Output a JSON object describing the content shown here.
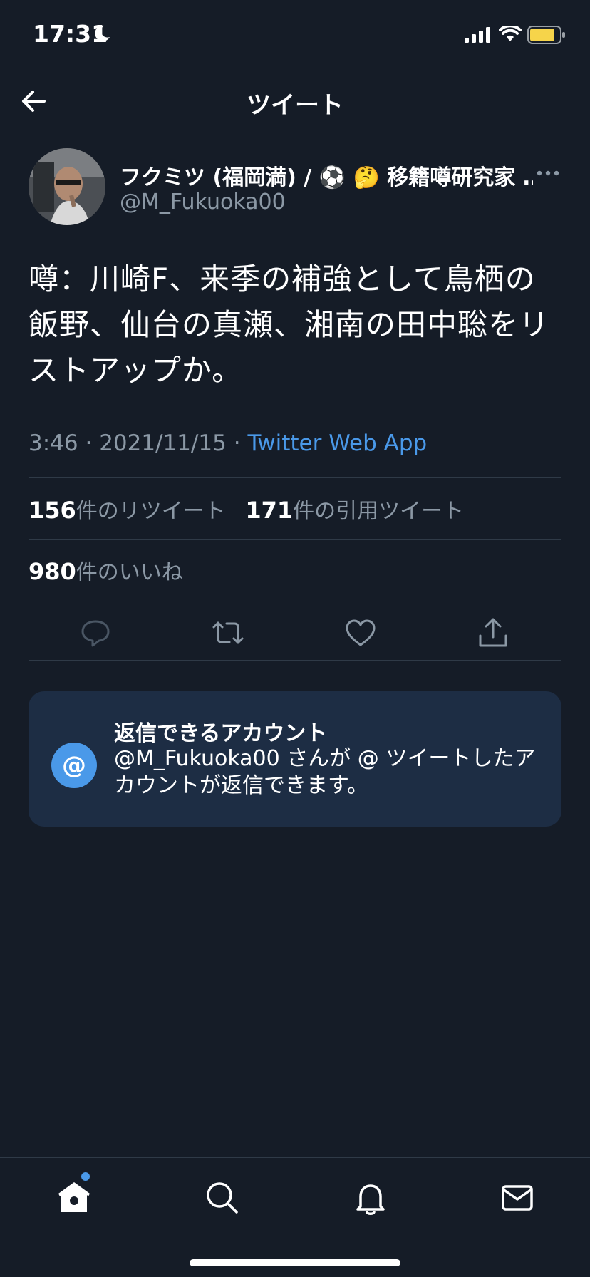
{
  "status_bar": {
    "time": "17:31"
  },
  "header": {
    "title": "ツイート"
  },
  "author": {
    "name": "フクミツ (福岡満) / ⚽ 🤔 移籍噂研究家 …",
    "handle": "@M_Fukuoka00"
  },
  "tweet": {
    "text": "噂：川崎F、来季の補強として鳥栖の飯野、仙台の真瀬、湘南の田中聡をリストアップか。",
    "time": "3:46",
    "date": "2021/11/15",
    "separator": "·",
    "source": "Twitter Web App"
  },
  "stats": {
    "retweets_count": "156",
    "retweets_label": "件のリツイート",
    "quotes_count": "171",
    "quotes_label": "件の引用ツイート",
    "likes_count": "980",
    "likes_label": "件のいいね"
  },
  "reply_card": {
    "icon_text": "@",
    "title": "返信できるアカウント",
    "description": "@M_Fukuoka00 さんが @ ツイートしたアカウントが返信できます。"
  },
  "icons": {
    "back": "arrow-left-icon",
    "reply": "reply-icon",
    "retweet": "retweet-icon",
    "like": "heart-icon",
    "share": "share-icon",
    "home": "home-icon",
    "search": "search-icon",
    "notifications": "bell-icon",
    "messages": "mail-icon"
  },
  "colors": {
    "background": "#151c27",
    "accent": "#4a99e9",
    "secondary_text": "#8b98a5",
    "card": "#1d2d44"
  }
}
